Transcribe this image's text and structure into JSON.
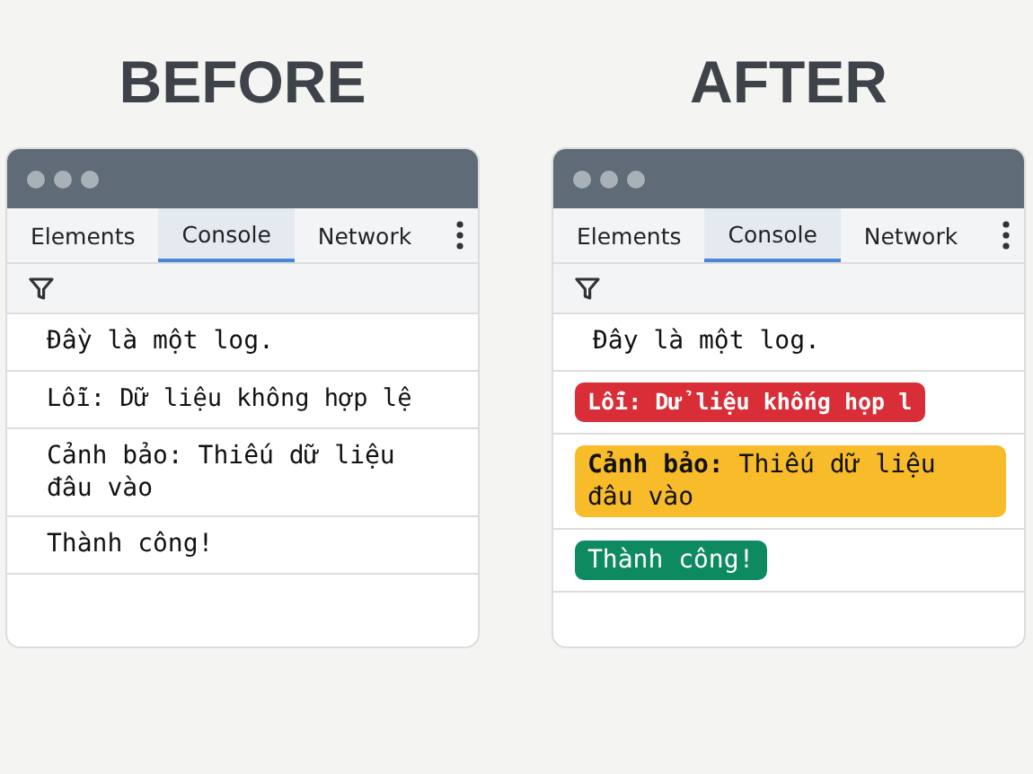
{
  "panels": [
    {
      "heading": "BEFORE",
      "highlighted": false,
      "tabs": [
        {
          "label": "Elements",
          "selected": false
        },
        {
          "label": "Console",
          "selected": true
        },
        {
          "label": "Network",
          "selected": false
        }
      ],
      "messages": [
        {
          "kind": "log",
          "text": "Đầy là một log."
        },
        {
          "kind": "error",
          "text": "Lỗi: Dữ liệu không hợp lệ"
        },
        {
          "kind": "warning",
          "text": "Cảnh bảo: Thiếu dữ liệu đâu vào"
        },
        {
          "kind": "success",
          "text": "Thành công!"
        }
      ]
    },
    {
      "heading": "AFTER",
      "highlighted": true,
      "tabs": [
        {
          "label": "Elements",
          "selected": false
        },
        {
          "label": "Console",
          "selected": true
        },
        {
          "label": "Network",
          "selected": false
        }
      ],
      "messages": [
        {
          "kind": "log",
          "text": "Đây là một log."
        },
        {
          "kind": "error",
          "text": "Lỗi: Dử liệu khống họp l"
        },
        {
          "kind": "warning",
          "text": "**Cảnh bảo:** Thiếu dữ liệu đâu vào"
        },
        {
          "kind": "success",
          "text": "Thành công!"
        }
      ]
    }
  ]
}
